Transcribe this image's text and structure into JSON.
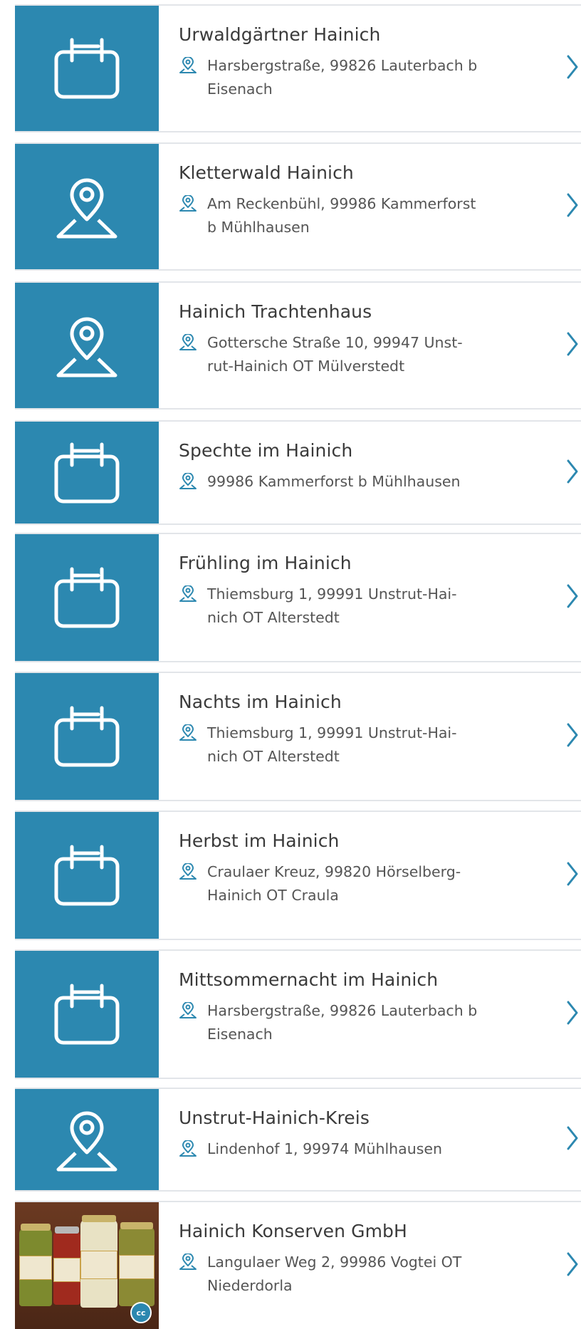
{
  "results": [
    {
      "type": "event",
      "icon": "calendar-icon",
      "title": "Urwaldgärtner Hainich",
      "address": [
        "Harsbergstraße, 99826 Lauterbach b",
        "Eisenach"
      ]
    },
    {
      "type": "poi",
      "icon": "map-pin-icon",
      "title": "Kletterwald Hainich",
      "address": [
        "Am Reckenbühl, 99986 Kammerforst",
        "b Mühlhausen"
      ]
    },
    {
      "type": "poi",
      "icon": "map-pin-icon",
      "title": "Hainich Trachtenhaus",
      "address": [
        "Gottersche Straße 10, 99947 Unst-",
        "rut-Hainich OT Mülverstedt"
      ]
    },
    {
      "type": "event",
      "icon": "calendar-icon",
      "title": "Spechte im Hainich",
      "address": [
        "99986 Kammerforst b Mühlhausen"
      ]
    },
    {
      "type": "event",
      "icon": "calendar-icon",
      "title": "Frühling im Hainich",
      "address": [
        "Thiemsburg 1, 99991 Unstrut-Hai-",
        "nich OT Alterstedt"
      ]
    },
    {
      "type": "event",
      "icon": "calendar-icon",
      "title": "Nachts im Hainich",
      "address": [
        "Thiemsburg 1, 99991 Unstrut-Hai-",
        "nich OT Alterstedt"
      ]
    },
    {
      "type": "event",
      "icon": "calendar-icon",
      "title": "Herbst im Hainich",
      "address": [
        "Craulaer Kreuz, 99820 Hörselberg-",
        "Hainich OT Craula"
      ]
    },
    {
      "type": "event",
      "icon": "calendar-icon",
      "title": "Mittsommernacht im Hainich",
      "address": [
        "Harsbergstraße, 99826 Lauterbach b",
        "Eisenach"
      ]
    },
    {
      "type": "poi",
      "icon": "map-pin-icon",
      "title": "Unstrut-Hainich-Kreis",
      "address": [
        "Lindenhof 1, 99974 Mühlhausen"
      ]
    },
    {
      "type": "photo",
      "icon": "photo-thumbnail",
      "badge": "cc",
      "title": "Hainich Konserven GmbH",
      "address": [
        "Langulaer Weg 2, 99986 Vogtei OT",
        "Niederdorla"
      ]
    }
  ],
  "colors": {
    "accent": "#2c88b0",
    "title_text": "#3a3a3a",
    "address_text": "#555555",
    "divider": "#e2e5e9"
  }
}
